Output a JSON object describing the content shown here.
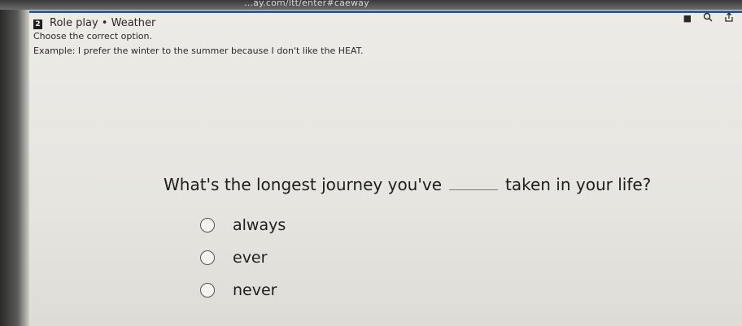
{
  "browser": {
    "url_text": "...ay.com/ltt/enter#caeway"
  },
  "toolbar": {
    "icons": [
      "square-icon",
      "search-icon",
      "share-icon"
    ]
  },
  "exercise": {
    "number": "2",
    "title": "Role play • Weather",
    "instruction": "Choose the correct option.",
    "example": "Example: I prefer the winter to the summer because I don't like the HEAT.",
    "question_before": "What's the longest journey you've",
    "question_after": "taken in your life?",
    "options": [
      "always",
      "ever",
      "never"
    ]
  }
}
